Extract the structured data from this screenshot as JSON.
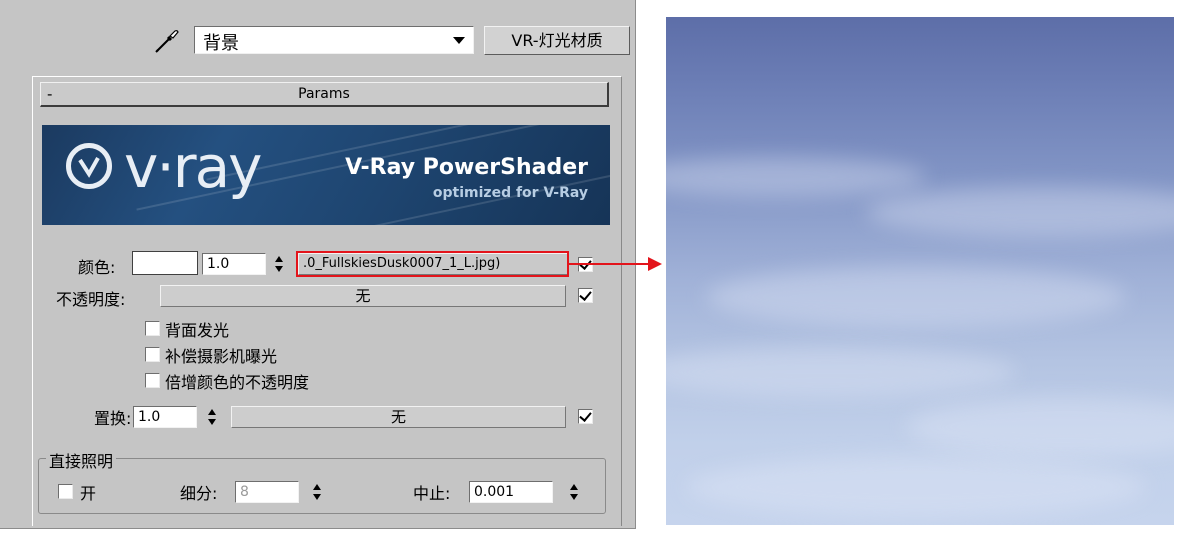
{
  "toolbar": {
    "eyedropper_icon": "eyedropper-icon",
    "material_name": "背景",
    "material_type_button": "VR-灯光材质"
  },
  "rollout": {
    "collapse_symbol": "-",
    "title": "Params",
    "banner": {
      "logo_text": "v·ray",
      "title": "V-Ray PowerShader",
      "subtitle": "optimized for V-Ray"
    }
  },
  "params": {
    "color_label": "颜色:",
    "color_multiplier": "1.0",
    "color_map": ".0_FullskiesDusk0007_1_L.jpg)",
    "color_map_enabled": true,
    "opacity_label": "不透明度:",
    "opacity_map": "无",
    "opacity_map_enabled": true,
    "emit_on_back_side": "背面发光",
    "compensate_camera_exposure": "补偿摄影机曝光",
    "multiply_color_by_opacity": "倍增颜色的不透明度",
    "displace_label": "置换:",
    "displace_amount": "1.0",
    "displace_map": "无",
    "displace_map_enabled": true
  },
  "direct_illumination": {
    "group_title": "直接照明",
    "on_label": "开",
    "subdivs_label": "细分:",
    "subdivs_value": "8",
    "cutoff_label": "中止:",
    "cutoff_value": "0.001"
  },
  "colors": {
    "panel_bg": "#c5c5c5",
    "highlight": "#e3141b",
    "sky_top": "#5d6ea8",
    "sky_bottom": "#c6d4ed"
  }
}
